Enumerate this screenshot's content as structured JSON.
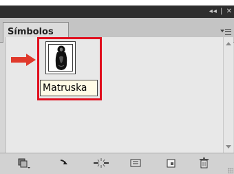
{
  "title_bar": {
    "controls": "◂◂ | ✕"
  },
  "panel": {
    "tab_label": "Símbolos"
  },
  "symbols": [
    {
      "label": "Matruska",
      "icon": "matryoshka-doll-icon"
    }
  ],
  "annotation": {
    "arrow_color": "#e0392b",
    "highlight_color": "#e00f1e"
  },
  "toolbar": {
    "tools": [
      "symbol-libraries-menu-icon",
      "place-symbol-instance-icon",
      "break-link-to-symbol-icon",
      "symbol-options-icon",
      "new-symbol-icon",
      "delete-symbol-icon"
    ]
  }
}
